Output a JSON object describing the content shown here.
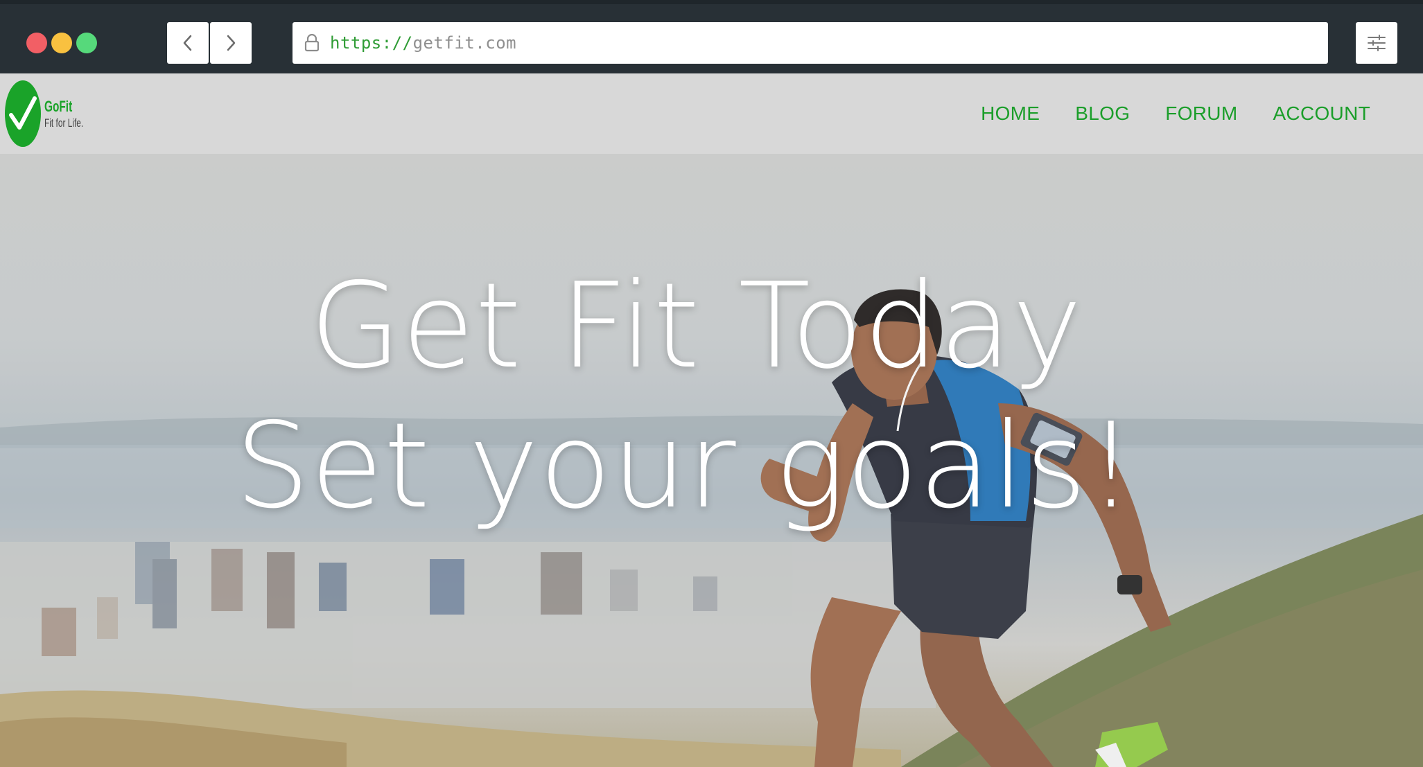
{
  "browser": {
    "url_scheme": "https://",
    "url_host": "getfit.com",
    "icons": {
      "back": "chevron-left-icon",
      "forward": "chevron-right-icon",
      "lock": "lock-icon",
      "menu": "sliders-icon"
    },
    "traffic_light_colors": [
      "#f25f65",
      "#f9c140",
      "#56d97b"
    ]
  },
  "site": {
    "logo": {
      "name": "GoFit",
      "tagline": "Fit for Life.",
      "icon": "checkmark-icon",
      "color": "#1aa329"
    },
    "nav": [
      {
        "label": "HOME"
      },
      {
        "label": "BLOG"
      },
      {
        "label": "FORUM"
      },
      {
        "label": "ACCOUNT"
      }
    ],
    "accent_color": "#1b9e2a"
  },
  "hero": {
    "line1": "Get Fit Today",
    "line2": "Set your goals!",
    "image": "runner-on-hillside-over-city-photo"
  }
}
